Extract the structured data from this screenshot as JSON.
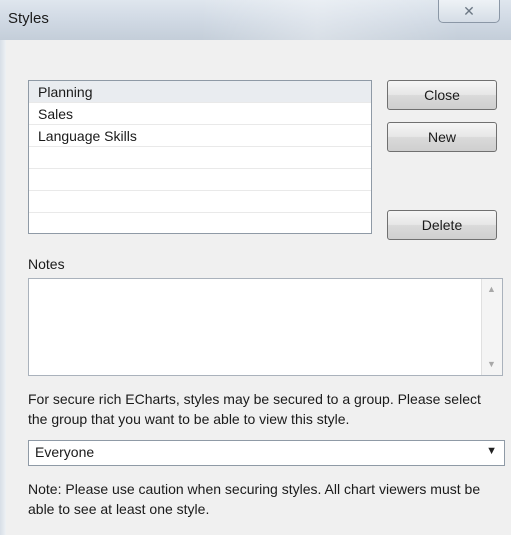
{
  "window": {
    "title": "Styles",
    "close_glyph": "✕"
  },
  "styles_list": {
    "items": [
      "Planning",
      "Sales",
      "Language Skills",
      "",
      "",
      ""
    ],
    "selected": "Planning"
  },
  "buttons": {
    "close": "Close",
    "new": "New",
    "delete": "Delete"
  },
  "notes": {
    "label": "Notes",
    "value": ""
  },
  "security": {
    "info": "For secure rich ECharts, styles may be secured to a group. Please select the group that you want to be able to view this style.",
    "group_selected": "Everyone",
    "note": "Note: Please use caution when securing styles. All chart viewers must be able to see at least one style."
  },
  "icons": [
    "close-icon",
    "scroll-up-icon",
    "scroll-down-icon",
    "dropdown-arrow-icon"
  ]
}
